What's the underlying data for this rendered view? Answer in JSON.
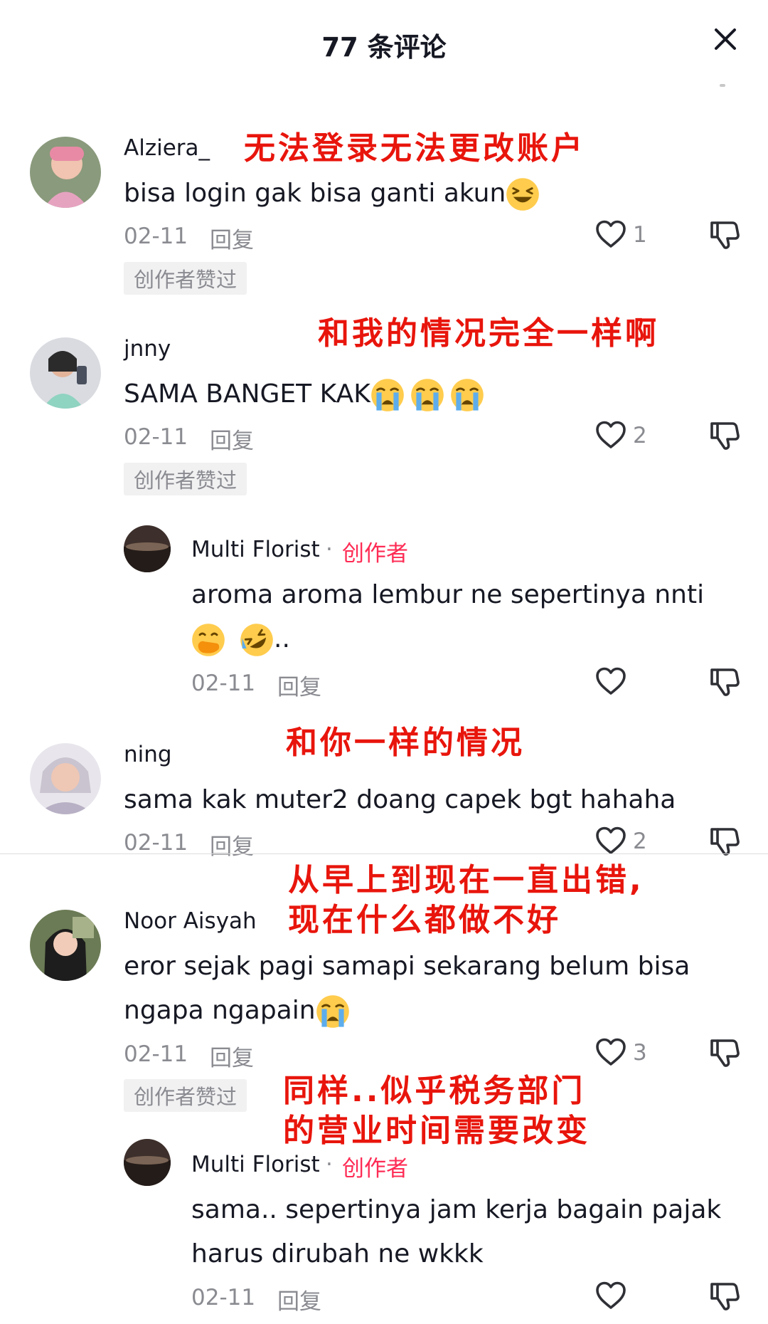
{
  "header": {
    "title": "77 条评论"
  },
  "colors": {
    "accent": "#fe2c55",
    "annotation": "#e8150c",
    "meta": "#8a8b91"
  },
  "comments": [
    {
      "username": "Alziera_",
      "text": "bisa login gak bisa ganti akun",
      "date": "02-11",
      "reply": "回复",
      "likes": "1",
      "badge": "创作者赞过",
      "annotation": "无法登录无法更改账户"
    },
    {
      "username": "jnny",
      "text": "SAMA BANGET KAK",
      "date": "02-11",
      "reply": "回复",
      "likes": "2",
      "badge": "创作者赞过",
      "annotation": "和我的情况完全一样啊",
      "reply_thread": {
        "username": "Multi Florist",
        "dot": "·",
        "creator_tag": "创作者",
        "text_line1": "aroma aroma lembur ne sepertinya nnti",
        "text_line2": "..",
        "date": "02-11",
        "reply": "回复"
      }
    },
    {
      "username": "ning",
      "text": "sama kak muter2 doang capek bgt hahaha",
      "date": "02-11",
      "reply": "回复",
      "likes": "2",
      "annotation": "和你一样的情况"
    },
    {
      "username": "Noor Aisyah",
      "text_line1": "eror sejak pagi samapi sekarang belum bisa",
      "text_line2": "ngapa ngapain",
      "date": "02-11",
      "reply": "回复",
      "likes": "3",
      "badge": "创作者赞过",
      "annotation_line1": "从早上到现在一直出错,",
      "annotation_line2": "现在什么都做不好",
      "reply_annotation_line1": "同样..似乎税务部门",
      "reply_annotation_line2": "的营业时间需要改变",
      "reply_thread": {
        "username": "Multi Florist",
        "dot": "·",
        "creator_tag": "创作者",
        "text_line1": "sama.. sepertinya jam kerja bagain pajak",
        "text_line2": "harus dirubah ne wkkk",
        "date": "02-11",
        "reply": "回复"
      }
    }
  ],
  "icons": {
    "close": "close-icon",
    "like": "heart-outline-icon",
    "dislike": "thumbs-down-icon",
    "laughing": "grinning-squinting-face-emoji",
    "crying": "loudly-crying-face-emoji",
    "hand_over_mouth": "face-with-hand-over-mouth-emoji",
    "rofl": "rolling-on-floor-laughing-emoji"
  }
}
